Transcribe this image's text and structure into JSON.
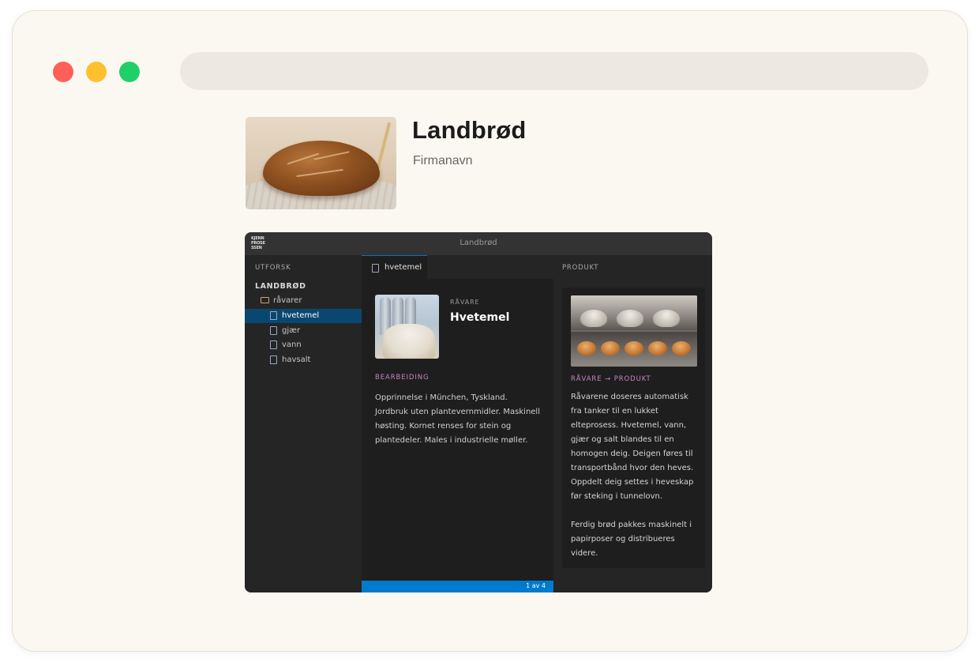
{
  "window": {
    "controls": [
      "close",
      "minimize",
      "maximize"
    ],
    "address": ""
  },
  "product": {
    "name": "Landbrød",
    "company": "Firmanavn"
  },
  "app": {
    "logo_lines": [
      "KJENN",
      "PROSE",
      "SSEN"
    ],
    "title": "Landbrød",
    "sidebar": {
      "heading": "UTFORSK",
      "project": "LANDBRØD",
      "folder": "råvarer",
      "files": [
        "hvetemel",
        "gjær",
        "vann",
        "havsalt"
      ],
      "selected": "hvetemel"
    },
    "editor": {
      "tab": "hvetemel",
      "kicker": "RÅVARE",
      "heading": "Hvetemel",
      "section": "BEARBEIDING",
      "body": "Opprinnelse i München, Tyskland. Jordbruk uten plantevernmidler. Maskinell høsting. Kornet renses for stein og plantedeler. Males i industrielle møller.",
      "status": "1 av 4"
    },
    "panel": {
      "heading": "PRODUKT",
      "label": "RÅVARE → PRODUKT",
      "text": "Råvarene doseres automatisk fra tanker til en lukket elteprosess. Hvetemel, vann, gjær og salt blandes til en homogen deig.  Deigen føres til transportbånd hvor den heves. Oppdelt deig settes i heveskap før steking i tunnelovn.\n\nFerdig brød pakkes maskinelt i papirposer og distribueres videre."
    }
  },
  "colors": {
    "close": "#fe5f57",
    "minimize": "#fec02f",
    "maximize": "#1fd068",
    "accent": "#007acc",
    "section_label": "#c586c0"
  }
}
